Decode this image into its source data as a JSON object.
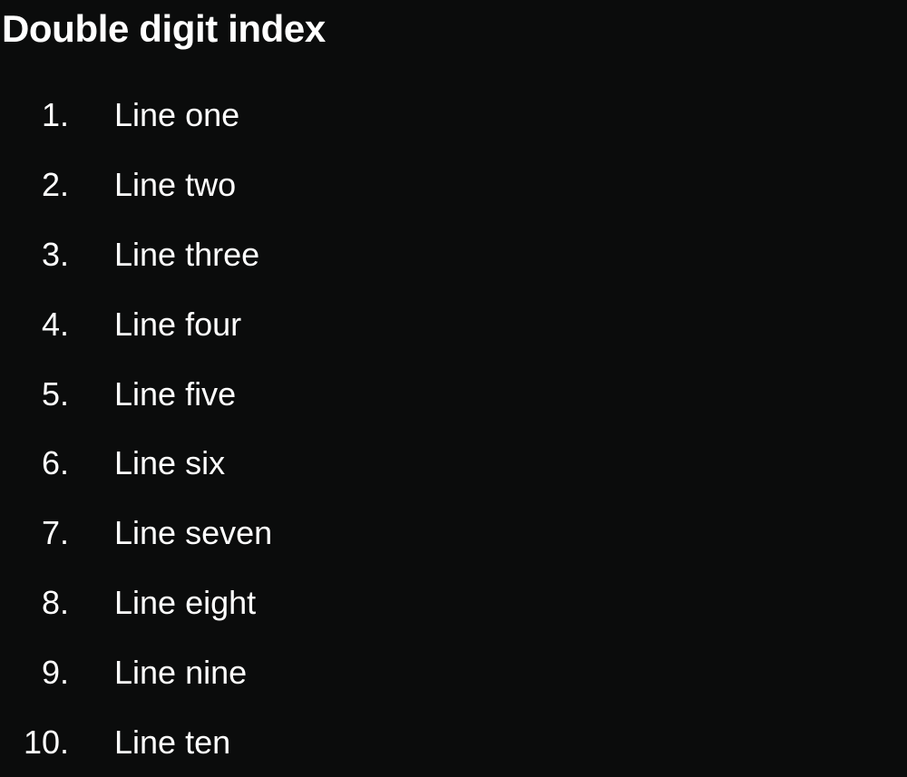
{
  "title": "Double digit index",
  "list": {
    "items": [
      {
        "number": "1.",
        "text": "Line one"
      },
      {
        "number": "2.",
        "text": "Line two"
      },
      {
        "number": "3.",
        "text": "Line three"
      },
      {
        "number": "4.",
        "text": "Line four"
      },
      {
        "number": "5.",
        "text": "Line five"
      },
      {
        "number": "6.",
        "text": "Line six"
      },
      {
        "number": "7.",
        "text": "Line seven"
      },
      {
        "number": "8.",
        "text": "Line eight"
      },
      {
        "number": "9.",
        "text": "Line nine"
      },
      {
        "number": "10.",
        "text": "Line ten"
      }
    ]
  },
  "colors": {
    "background": "#0b0c0c",
    "text": "#ffffff"
  }
}
